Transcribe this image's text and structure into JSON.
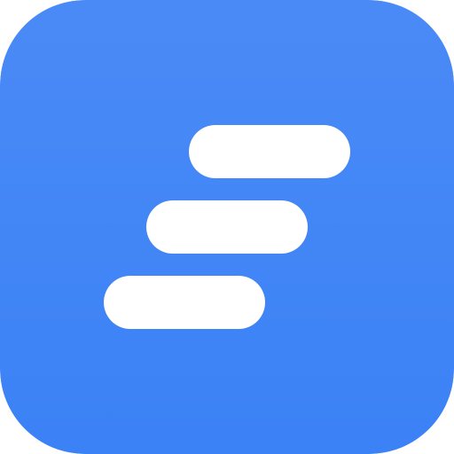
{
  "icon": {
    "name": "staggered-bars-app-icon",
    "background_color_top": "#4A8AF6",
    "background_color_bottom": "#3B82F6",
    "bar_color": "#FFFFFF"
  }
}
